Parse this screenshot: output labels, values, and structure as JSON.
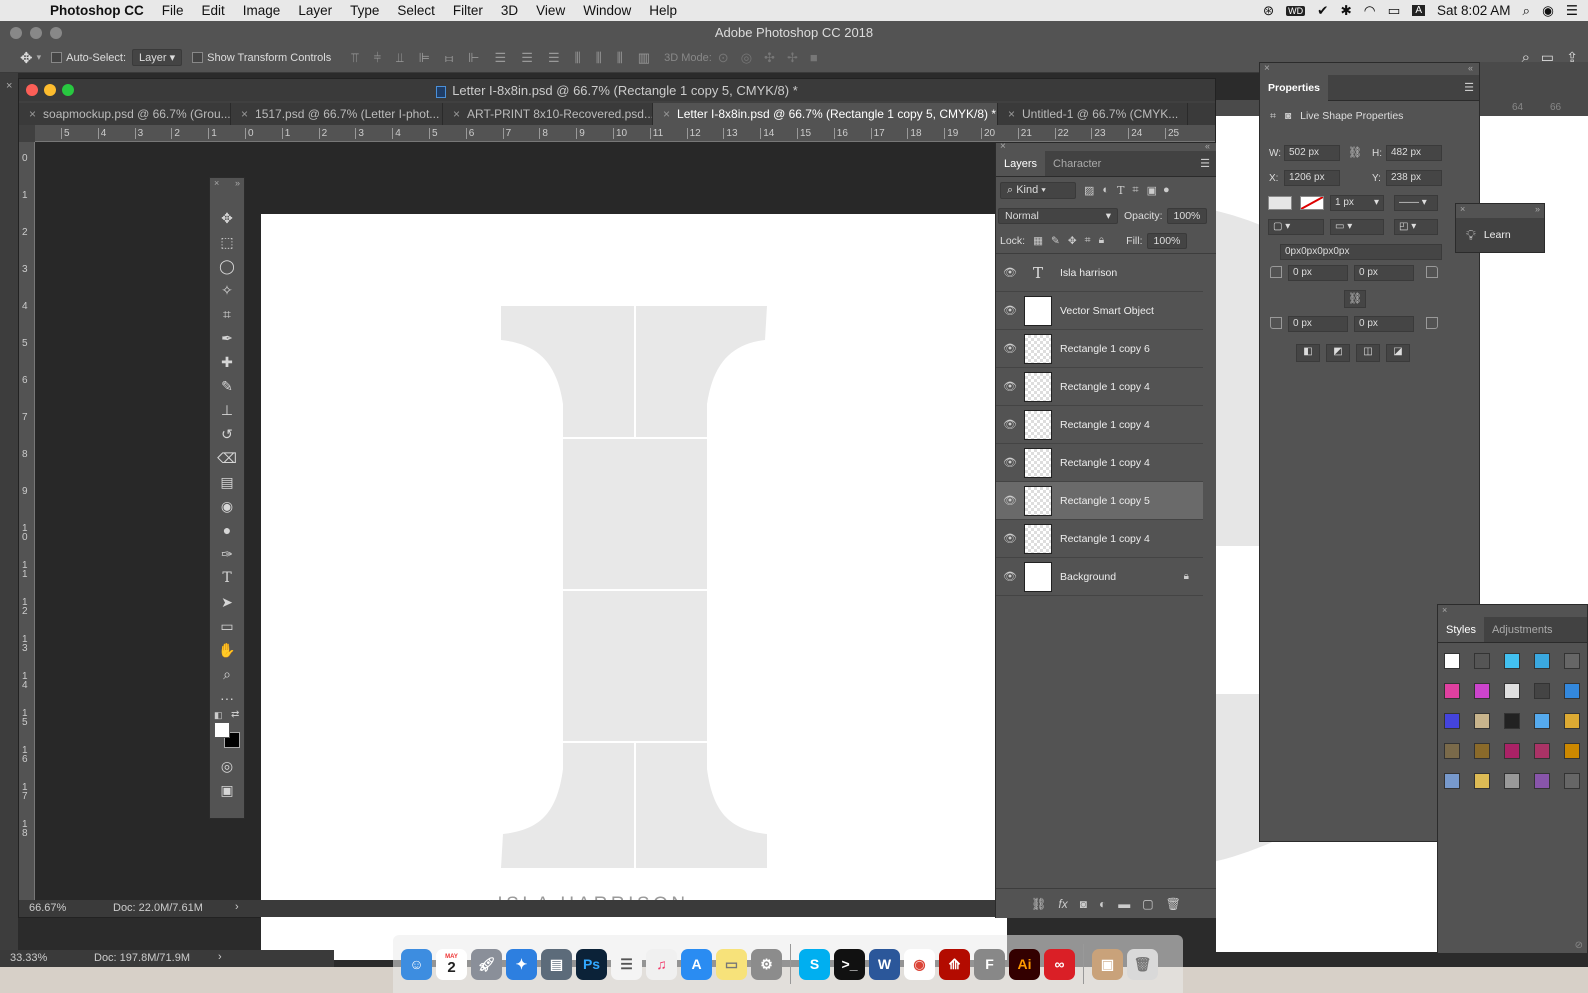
{
  "menubar": {
    "app": "Photoshop CC",
    "items": [
      "File",
      "Edit",
      "Image",
      "Layer",
      "Type",
      "Select",
      "Filter",
      "3D",
      "View",
      "Window",
      "Help"
    ],
    "clock": "Sat 8:02 AM"
  },
  "app_title": "Adobe Photoshop CC 2018",
  "options_bar": {
    "auto_select_label": "Auto-Select:",
    "auto_select_value": "Layer",
    "show_transform_label": "Show Transform Controls",
    "mode_3d_label": "3D Mode:"
  },
  "document": {
    "title": "Letter I-8x8in.psd @ 66.7% (Rectangle 1 copy 5, CMYK/8) *",
    "tabs": [
      {
        "label": "soapmockup.psd @ 66.7% (Grou..."
      },
      {
        "label": "1517.psd @ 66.7% (Letter I-phot..."
      },
      {
        "label": "ART-PRINT 8x10-Recovered.psd..."
      },
      {
        "label": "Letter I-8x8in.psd @ 66.7% (Rectangle 1 copy 5, CMYK/8) *"
      },
      {
        "label": "Untitled-1 @ 66.7% (CMYK..."
      }
    ],
    "active_tab": 3,
    "ruler_h": [
      "5",
      "4",
      "3",
      "2",
      "1",
      "0",
      "1",
      "2",
      "3",
      "4",
      "5",
      "6",
      "7",
      "8",
      "9",
      "10",
      "11",
      "12",
      "13",
      "14",
      "15",
      "16",
      "17",
      "18",
      "19",
      "20",
      "21",
      "22",
      "23",
      "24",
      "25"
    ],
    "ruler_v": [
      "0",
      "1",
      "2",
      "3",
      "4",
      "5",
      "6",
      "7",
      "8",
      "9",
      "10",
      "11",
      "12",
      "13",
      "14",
      "15",
      "16",
      "17",
      "18"
    ],
    "canvas_name": "ISLA HARRISON",
    "zoom": "66.67%",
    "doc_size": "Doc: 22.0M/7.61M"
  },
  "layers_panel": {
    "tabs": [
      "Layers",
      "Character"
    ],
    "kind_label": "Kind",
    "blend_mode": "Normal",
    "opacity_label": "Opacity:",
    "opacity_value": "100%",
    "lock_label": "Lock:",
    "fill_label": "Fill:",
    "fill_value": "100%",
    "layers": [
      {
        "name": "Isla harrison",
        "type": "text"
      },
      {
        "name": "Vector Smart Object",
        "type": "smart"
      },
      {
        "name": "Rectangle 1 copy 6",
        "type": "shape"
      },
      {
        "name": "Rectangle 1 copy 4",
        "type": "shape"
      },
      {
        "name": "Rectangle 1 copy 4",
        "type": "shape"
      },
      {
        "name": "Rectangle 1 copy 4",
        "type": "shape"
      },
      {
        "name": "Rectangle 1 copy 5",
        "type": "shape",
        "selected": true
      },
      {
        "name": "Rectangle 1 copy 4",
        "type": "shape"
      },
      {
        "name": "Background",
        "type": "background",
        "locked": true
      }
    ]
  },
  "properties": {
    "title": "Properties",
    "subtitle": "Live Shape Properties",
    "w_label": "W:",
    "w": "502 px",
    "h_label": "H:",
    "h": "482 px",
    "x_label": "X:",
    "x": "1206 px",
    "y_label": "Y:",
    "y": "238 px",
    "stroke_width": "1 px",
    "radius_text": "0px0px0px0px",
    "r1": "0 px",
    "r2": "0 px",
    "r3": "0 px",
    "r4": "0 px"
  },
  "learn_label": "Learn",
  "styles_panel": {
    "tabs": [
      "Styles",
      "Adjustments"
    ]
  },
  "bottom_status": {
    "zoom": "33.33%",
    "doc_size": "Doc: 197.8M/71.9M"
  },
  "dock": {
    "calendar_month": "MAY",
    "calendar_day": "2"
  }
}
